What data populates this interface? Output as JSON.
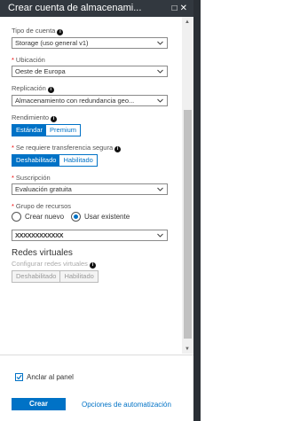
{
  "header": {
    "title": "Crear cuenta de almacenami...",
    "minimize_icon": "restore-icon",
    "close_icon": "close-icon"
  },
  "fields": {
    "account_type": {
      "label": "Tipo de cuenta",
      "value": "Storage (uso general v1)"
    },
    "location": {
      "label": "Ubicación",
      "value": "Oeste de Europa"
    },
    "replication": {
      "label": "Replicación",
      "value": "Almacenamiento con redundancia geo..."
    },
    "performance": {
      "label": "Rendimiento",
      "options": [
        "Estándar",
        "Premium"
      ],
      "selected": "Estándar"
    },
    "secure_transfer": {
      "label": "Se requiere transferencia segura",
      "options": [
        "Deshabilitado",
        "Habilitado"
      ],
      "selected": "Deshabilitado"
    },
    "subscription": {
      "label": "Suscripción",
      "value": "Evaluación gratuita"
    },
    "resource_group": {
      "label": "Grupo de recursos",
      "radio_new": "Crear nuevo",
      "radio_existing": "Usar existente",
      "selected": "Usar existente",
      "value": "XXXXXXXXXXXX"
    }
  },
  "virtual_networks": {
    "title": "Redes virtuales",
    "label": "Configurar redes virtuales",
    "options": [
      "Deshabilitado",
      "Habilitado"
    ]
  },
  "footer": {
    "pin_label": "Anclar al panel",
    "pin_checked": true,
    "create_label": "Crear",
    "automation_label": "Opciones de automatización"
  },
  "colors": {
    "accent": "#0072c6",
    "header_bg": "#32383f",
    "required": "#e00000"
  }
}
